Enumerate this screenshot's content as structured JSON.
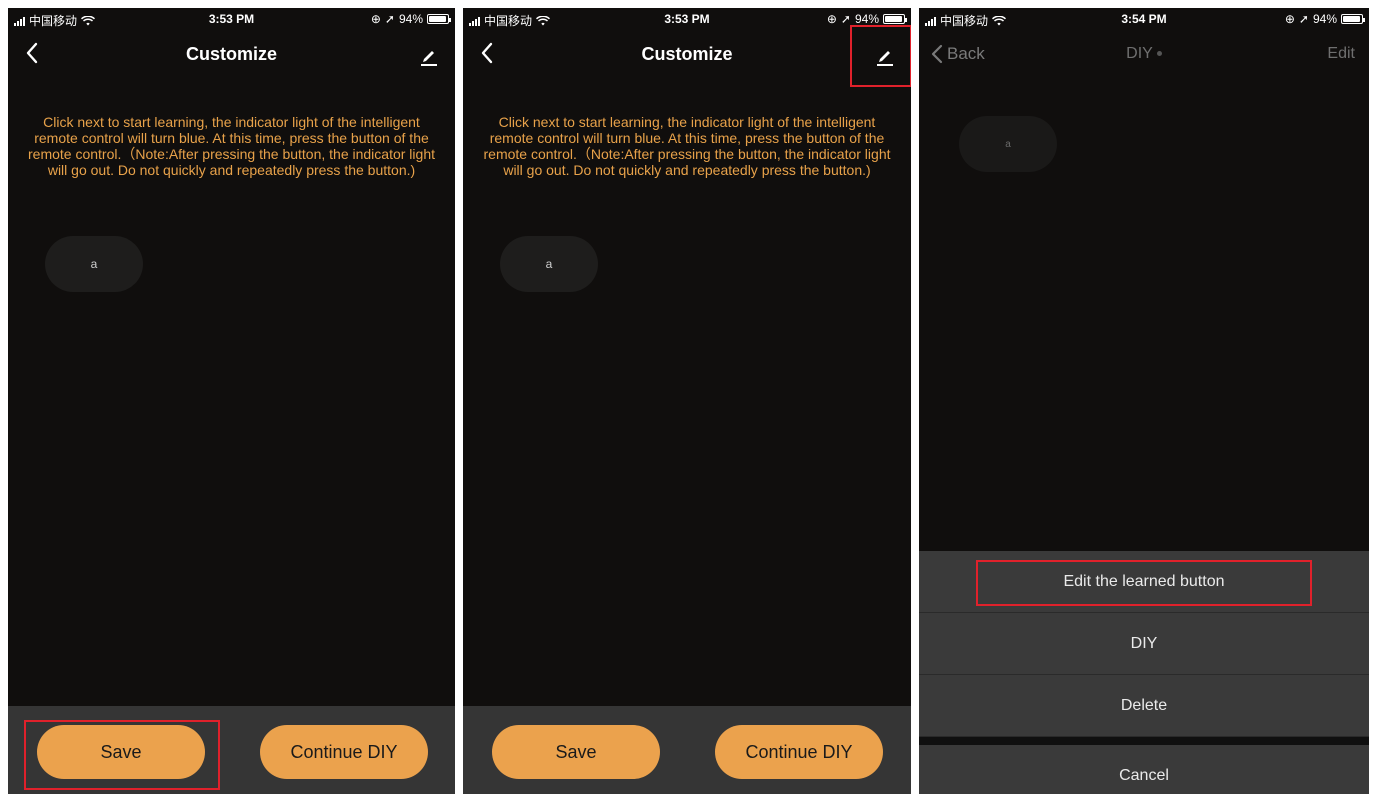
{
  "status_bar": {
    "carrier": "中国移动",
    "battery": "94%",
    "battery_level": 0.94
  },
  "phone1": {
    "time": "3:53 PM",
    "title": "Customize",
    "instructions": "Click next to start learning, the indicator light of the intelligent remote control will turn blue. At this time, press the button of the remote control.（Note:After pressing the button, the indicator light will go out. Do not quickly and repeatedly press the button.)",
    "learned_button": "a",
    "save_label": "Save",
    "continue_label": "Continue DIY"
  },
  "phone2": {
    "time": "3:53 PM",
    "title": "Customize",
    "instructions": "Click next to start learning, the indicator light of the intelligent remote control will turn blue. At this time, press the button of the remote control.（Note:After pressing the button, the indicator light will go out. Do not quickly and repeatedly press the button.)",
    "learned_button": "a",
    "save_label": "Save",
    "continue_label": "Continue DIY"
  },
  "phone3": {
    "time": "3:54 PM",
    "back_label": "Back",
    "title": "DIY",
    "edit_label": "Edit",
    "learned_button": "a",
    "sheet": {
      "edit_learned": "Edit the learned button",
      "diy": "DIY",
      "delete": "Delete",
      "cancel": "Cancel"
    }
  },
  "colors": {
    "accent": "#eba24d",
    "instruction_text": "#e8a24a",
    "highlight": "#e0212b",
    "background": "#100e0d"
  }
}
